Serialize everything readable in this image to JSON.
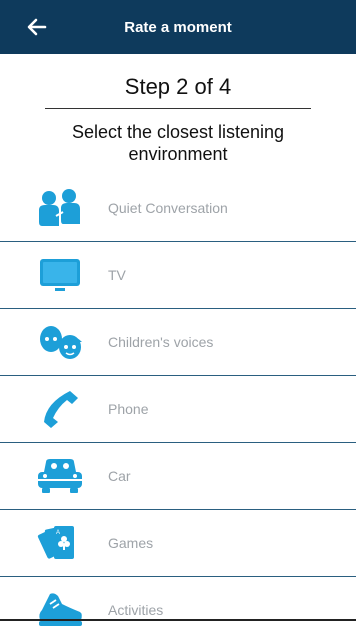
{
  "header": {
    "title": "Rate a moment",
    "back_icon": "arrow-left-icon"
  },
  "step": "Step 2 of 4",
  "instruction": "Select the closest listening environment",
  "environments": [
    {
      "label": "Quiet Conversation",
      "icon": "people-icon"
    },
    {
      "label": "TV",
      "icon": "tv-icon"
    },
    {
      "label": "Children's voices",
      "icon": "children-icon"
    },
    {
      "label": "Phone",
      "icon": "phone-icon"
    },
    {
      "label": "Car",
      "icon": "car-icon"
    },
    {
      "label": "Games",
      "icon": "cards-icon"
    },
    {
      "label": "Activities",
      "icon": "shoe-icon"
    }
  ],
  "colors": {
    "header": "#0e3a5c",
    "icon": "#1d9fd8",
    "label": "#9ea3a8",
    "divider": "#2a5f80"
  }
}
